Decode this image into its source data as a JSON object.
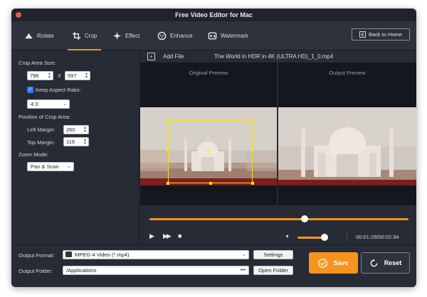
{
  "window": {
    "title": "Free Video Editor for Mac"
  },
  "toolbar": {
    "tabs": [
      {
        "label": "Rotate",
        "icon": "rotate-icon"
      },
      {
        "label": "Crop",
        "icon": "crop-icon",
        "active": true
      },
      {
        "label": "Effect",
        "icon": "effect-icon"
      },
      {
        "label": "Enhance",
        "icon": "enhance-icon"
      },
      {
        "label": "Watermark",
        "icon": "watermark-icon"
      }
    ],
    "back_label": "Back to Home"
  },
  "crop_panel": {
    "area_size_label": "Crop Area Size:",
    "width": "796",
    "separator": "X",
    "height": "597",
    "keep_aspect_label": "Keep Aspect Ratio:",
    "keep_aspect_checked": true,
    "aspect_ratio": "4:3",
    "position_label": "Position of Crop Area:",
    "left_margin_label": "Left Margin:",
    "left_margin": "260",
    "top_margin_label": "Top Margin:",
    "top_margin": "119",
    "zoom_label": "Zoom Mode:",
    "zoom_mode": "Pan & Scan"
  },
  "preview": {
    "add_file_label": "Add File",
    "filename": "The World in HDR in 4K (ULTRA HD)_1_0.mp4",
    "original_label": "Original Preview",
    "output_label": "Output Preview"
  },
  "playback": {
    "seek_progress": 0.6,
    "volume_level": 0.9,
    "timecode": "00:01:28/00:02:34"
  },
  "output": {
    "format_label": "Output Format:",
    "format_value": "MPEG-4 Video (*.mp4)",
    "settings_label": "Settings",
    "folder_label": "Output Folder:",
    "folder_value": "/Applications",
    "folder_more": "•••",
    "open_folder_label": "Open Folder",
    "save_label": "Save",
    "reset_label": "Reset"
  },
  "colors": {
    "accent": "#f7931e",
    "crop_frame": "#f3e01b",
    "background": "#262b36"
  }
}
